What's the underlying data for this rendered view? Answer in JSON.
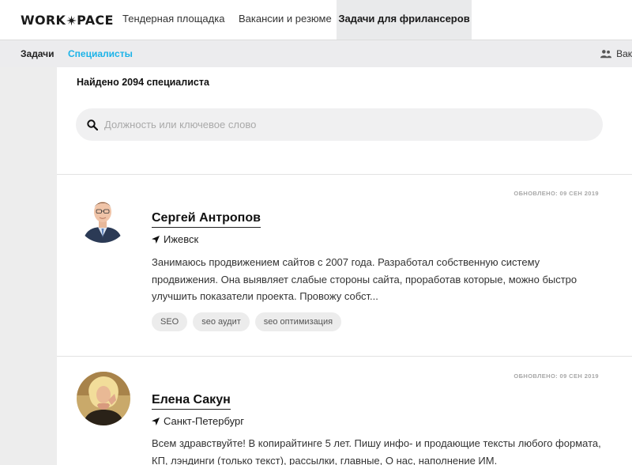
{
  "header": {
    "logo_left": "WORK",
    "logo_right": "PACE",
    "tabs": [
      {
        "label": "Тендерная площадка"
      },
      {
        "label": "Вакансии и резюме"
      },
      {
        "label": "Задачи для фрилансеров"
      }
    ]
  },
  "subnav": {
    "items": [
      {
        "label": "Задачи"
      },
      {
        "label": "Специалисты"
      }
    ],
    "right_label": "Вак"
  },
  "results": {
    "found_text": "Найдено 2094 специалиста",
    "search_placeholder": "Должность или ключевое слово"
  },
  "specialists": [
    {
      "name": "Сергей Антропов",
      "city": "Ижевск",
      "updated": "ОБНОВЛЕНО: 09 СЕН 2019",
      "description": "Занимаюсь продвижением сайтов с 2007 года. Разработал собственную систему продвижения. Она выявляет слабые стороны сайта, проработав которые, можно быстро улучшить показатели проекта. Провожу собст...",
      "tags": [
        "SEO",
        "seo аудит",
        "seo оптимизация"
      ]
    },
    {
      "name": "Елена Сакун",
      "city": "Санкт-Петербург",
      "updated": "ОБНОВЛЕНО: 09 СЕН 2019",
      "description": "Всем здравствуйте! В копирайтинге 5 лет. Пишу инфо- и продающие тексты любого формата, КП, лэндинги (только текст), рассылки, главные, О нас, наполнение ИМ.",
      "tags": []
    }
  ],
  "colors": {
    "accent": "#1cb3e8",
    "active_tab_bg": "#e9eaeb",
    "tag_bg": "#ececec"
  }
}
